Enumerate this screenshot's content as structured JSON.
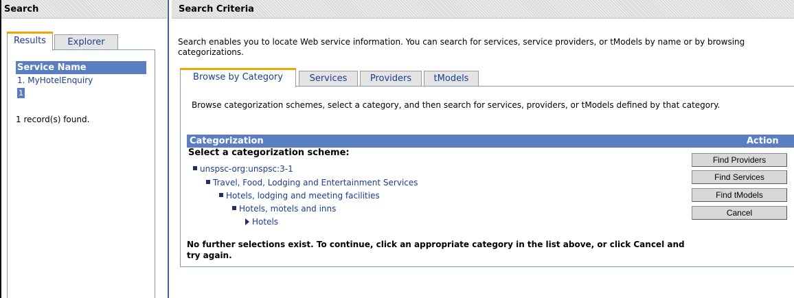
{
  "left_pane": {
    "title": "Search",
    "tabs": [
      {
        "label": "Results",
        "active": true
      },
      {
        "label": "Explorer",
        "active": false
      }
    ],
    "results": {
      "column_header": "Service Name",
      "rows": [
        "1. MyHotelEnquiry"
      ],
      "page": "1",
      "record_count_text": "1 record(s) found."
    }
  },
  "right_pane": {
    "title": "Search Criteria",
    "intro": "Search enables you to locate Web service information. You can search for services, service providers, or tModels by name or by browsing categorizations.",
    "tabs": [
      {
        "label": "Browse by Category",
        "active": true
      },
      {
        "label": "Services",
        "active": false
      },
      {
        "label": "Providers",
        "active": false
      },
      {
        "label": "tModels",
        "active": false
      }
    ],
    "browse": {
      "description": "Browse categorization schemes, select a category, and then search for services, providers, or tModels defined by that category.",
      "table_header": {
        "categorization": "Categorization",
        "action": "Action"
      },
      "select_prompt": "Select a categorization scheme:",
      "tree": [
        {
          "label": "unspsc-org:unspsc:3-1",
          "level": 0
        },
        {
          "label": "Travel, Food, Lodging and Entertainment Services",
          "level": 1
        },
        {
          "label": "Hotels, lodging and meeting facilities",
          "level": 2
        },
        {
          "label": "Hotels, motels and inns",
          "level": 3
        },
        {
          "label": "Hotels",
          "level": 4,
          "selected": true
        }
      ],
      "actions": [
        "Find Providers",
        "Find Services",
        "Find tModels",
        "Cancel"
      ],
      "footer_message": "No further selections exist. To continue, click an appropriate category in the list above, or click Cancel and try again."
    }
  },
  "colors": {
    "header_blue": "#5b7ec2",
    "link_blue": "#1a3d8f",
    "active_tab_accent": "#f0a500",
    "frame_blue": "#3f5f9f"
  },
  "icons": {
    "tree_bullet": "square-bullet-icon",
    "selected_node": "triangle-right-icon"
  }
}
